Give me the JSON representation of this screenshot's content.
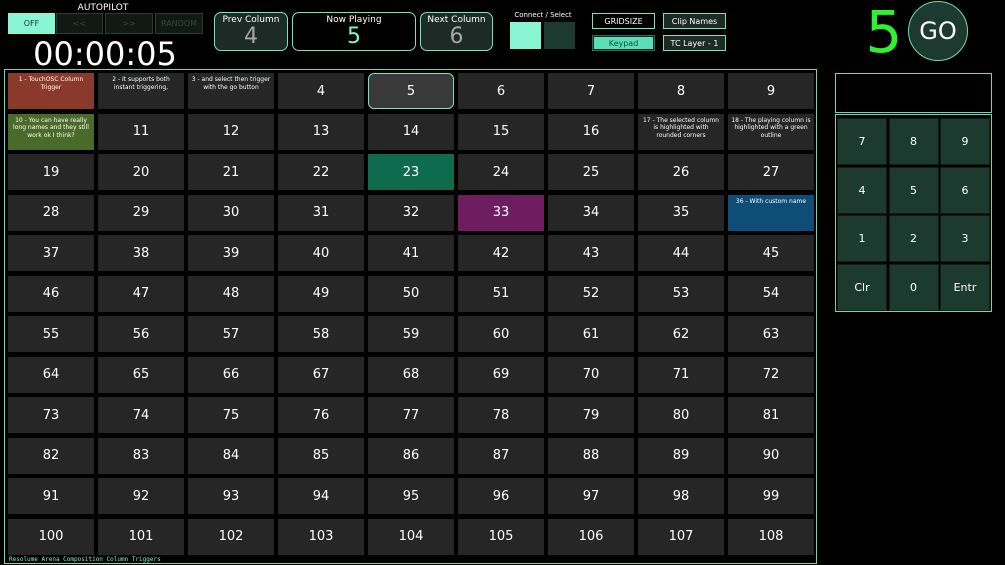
{
  "autopilot": {
    "title": "AUTOPILOT",
    "buttons": [
      "OFF",
      "<<",
      ">>",
      "RANDOM"
    ]
  },
  "timer": "00:00:05",
  "prev_column": {
    "label": "Prev Column",
    "value": "4"
  },
  "now_playing": {
    "label": "Now Playing",
    "value": "5"
  },
  "next_column": {
    "label": "Next Column",
    "value": "6"
  },
  "connect_select": {
    "label": "Connect / Select"
  },
  "settings": {
    "gridsize": "GRIDSIZE",
    "clip_names": "Clip Names",
    "keypad": "Keypad",
    "tc_layer": "TC Layer - 1"
  },
  "big_number": "5",
  "go_button": "GO",
  "footer": "Resolume Arena Composition Column Triggers",
  "grid_cells": [
    "1 - TouchOSC Column Trigger",
    "2 - It supports both instant triggering,",
    "3 - and select then trigger with the go button",
    "4",
    "5",
    "6",
    "7",
    "8",
    "9",
    "10 - You can have really long names and they still work ok I think?",
    "11",
    "12",
    "13",
    "14",
    "15",
    "16",
    "17 - The selected column is highlighted with rounded corners",
    "18 - The playing column is highlighted with a green outline",
    "19",
    "20",
    "21",
    "22",
    "23",
    "24",
    "25",
    "26",
    "27",
    "28",
    "29",
    "30",
    "31",
    "32",
    "33",
    "34",
    "35",
    "36 - With custom name",
    "37",
    "38",
    "39",
    "40",
    "41",
    "42",
    "43",
    "44",
    "45",
    "46",
    "47",
    "48",
    "49",
    "50",
    "51",
    "52",
    "53",
    "54",
    "55",
    "56",
    "57",
    "58",
    "59",
    "60",
    "61",
    "62",
    "63",
    "64",
    "65",
    "66",
    "67",
    "68",
    "69",
    "70",
    "71",
    "72",
    "73",
    "74",
    "75",
    "76",
    "77",
    "78",
    "79",
    "80",
    "81",
    "82",
    "83",
    "84",
    "85",
    "86",
    "87",
    "88",
    "89",
    "90",
    "91",
    "92",
    "93",
    "94",
    "95",
    "96",
    "97",
    "98",
    "99",
    "100",
    "101",
    "102",
    "103",
    "104",
    "105",
    "106",
    "107",
    "108"
  ],
  "cell_colors": {
    "1": "#8a3a2a",
    "10": "#4a6a2a",
    "23": "#0e6b4e",
    "33": "#6e1e60",
    "36": "#0e4d75"
  },
  "keypad": {
    "display_value": "",
    "keys": [
      "7",
      "8",
      "9",
      "4",
      "5",
      "6",
      "1",
      "2",
      "3",
      "Clr",
      "0",
      "Entr"
    ]
  }
}
